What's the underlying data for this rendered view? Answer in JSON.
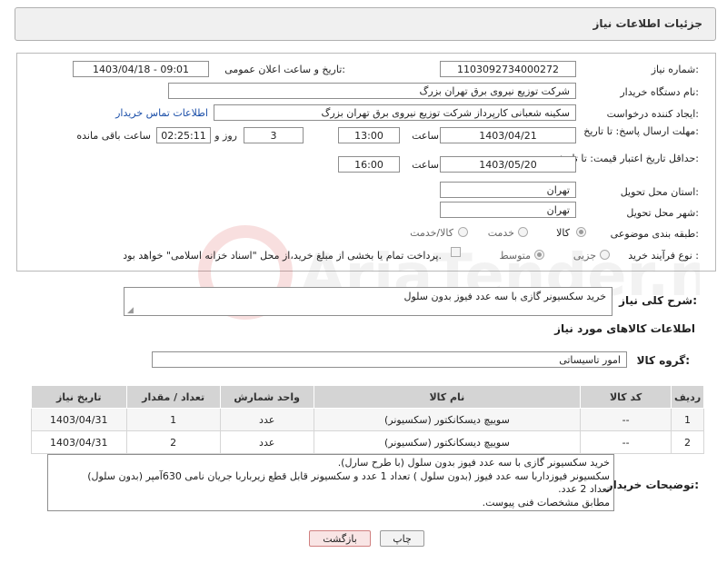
{
  "header": {
    "title": "جزئیات اطلاعات نیاز"
  },
  "fields": {
    "need_number_label": "شماره نیاز:",
    "need_number": "1103092734000272",
    "announce_label": "تاریخ و ساعت اعلان عمومی:",
    "announce_value": "1403/04/18 - 09:01",
    "buyer_org_label": "نام دستگاه خریدار:",
    "buyer_org": "شرکت توزیع نیروی برق تهران بزرگ",
    "creator_label": "ایجاد کننده درخواست:",
    "creator": "سکینه شعبانی کارپرداز شرکت توزیع نیروی برق تهران بزرگ",
    "contact_link": "اطلاعات تماس خریدار",
    "deadline_label": "مهلت ارسال پاسخ: تا تاریخ:",
    "deadline_date": "1403/04/21",
    "time_label": "ساعت",
    "deadline_time": "13:00",
    "days_value": "3",
    "days_label": "روز و",
    "remaining_time": "02:25:11",
    "remaining_label": "ساعت باقی مانده",
    "validity_label": "حداقل تاریخ اعتبار قیمت: تا تاریخ:",
    "validity_date": "1403/05/20",
    "validity_time": "16:00",
    "province_label": "استان محل تحویل:",
    "province": "تهران",
    "city_label": "شهر محل تحویل:",
    "city": "تهران",
    "category_label": "طبقه بندی موضوعی:",
    "category_options": [
      "کالا",
      "خدمت",
      "کالا/خدمت"
    ],
    "process_label": "نوع فرآیند خرید :",
    "process_options": [
      "جزیی",
      "متوسط"
    ],
    "payment_note": "پرداخت تمام یا بخشی از مبلغ خرید،از محل \"اسناد خزانه اسلامی\" خواهد بود."
  },
  "summary": {
    "label": "شرح کلی نیاز:",
    "value": "خرید سکسیونر گازی با سه عدد فیوز بدون سلول"
  },
  "goods": {
    "section_title": "اطلاعات کالاهای مورد نیاز",
    "group_label": "گروه کالا:",
    "group_value": "امور تاسیساتی"
  },
  "table": {
    "headers": [
      "ردیف",
      "کد کالا",
      "نام کالا",
      "واحد شمارش",
      "تعداد / مقدار",
      "تاریخ نیاز"
    ],
    "rows": [
      {
        "idx": "1",
        "code": "--",
        "name": "سوییچ دیسکانکتور (سکسیونر)",
        "unit": "عدد",
        "qty": "1",
        "date": "1403/04/31"
      },
      {
        "idx": "2",
        "code": "--",
        "name": "سوییچ دیسکانکتور (سکسیونر)",
        "unit": "عدد",
        "qty": "2",
        "date": "1403/04/31"
      }
    ]
  },
  "buyer_notes": {
    "label": "توضیحات خریدار:",
    "lines": [
      "خرید سکسیونر  گازی با سه عدد فیوز بدون سلول (با طرح سارل).",
      "سکسیونر فیوزداربا سه عدد فیوز (بدون سلول ) تعداد 1 عدد و سکسیونر قابل قطع زیرباربا جریان نامی 630آمپر (بدون سلول)",
      "تعداد 2 عدد.",
      "مطابق مشخصات فنی پیوست."
    ]
  },
  "buttons": {
    "print": "چاپ",
    "back": "بازگشت"
  },
  "watermark": {
    "text": "AriaTender.neT"
  },
  "colors": {
    "link": "#1a4ea8",
    "back_button_bg": "#f9e5e5",
    "back_button_border": "#d08080"
  }
}
